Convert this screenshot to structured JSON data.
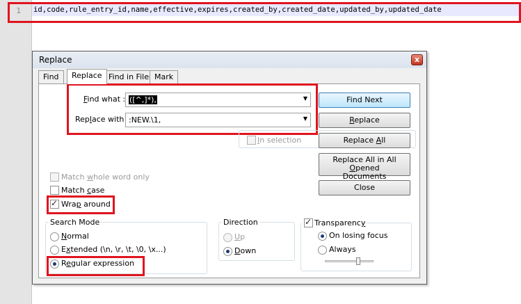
{
  "editor": {
    "line_number": "1",
    "code_line": "id,code,rule_entry_id,name,effective,expires,created_by,created_date,updated_by,updated_date"
  },
  "dialog": {
    "title": "Replace",
    "close_glyph": "x",
    "tabs": [
      "Find",
      "Replace",
      "Find in Files",
      "Mark"
    ],
    "active_tab": "Replace",
    "find_what": {
      "label_prefix": "",
      "label_mnemonic": "F",
      "label_rest": "ind what :",
      "value": "([^,]*),"
    },
    "replace_with": {
      "label_pre": "Rep",
      "label_mnemonic": "l",
      "label_post": "ace with :",
      "value": ":NEW.\\1,"
    },
    "in_selection": {
      "pre": "",
      "mnemonic": "I",
      "post": "n selection"
    },
    "buttons": {
      "find_next": "Find Next",
      "replace": {
        "mnemonic": "R",
        "rest": "eplace"
      },
      "replace_all": {
        "pre": "Replace ",
        "mnemonic": "A",
        "post": "ll"
      },
      "replace_all_opened_l1_pre": "Replace All in All ",
      "replace_all_opened_l1_mn": "O",
      "replace_all_opened_l1_post": "pened",
      "replace_all_opened_l2": "Documents",
      "close": "Close"
    },
    "options": {
      "match_whole_word": {
        "pre": "Match ",
        "mnemonic": "w",
        "post": "hole word only"
      },
      "match_case": {
        "pre": "Match ",
        "mnemonic": "c",
        "post": "ase"
      },
      "wrap_around": {
        "pre": "Wra",
        "mnemonic": "p",
        "post": " around"
      }
    },
    "search_mode": {
      "title": "Search Mode",
      "normal": {
        "pre": "",
        "mnemonic": "N",
        "post": "ormal"
      },
      "extended": {
        "pre": "E",
        "mnemonic": "x",
        "post": "tended (\\n, \\r, \\t, \\0, \\x...)"
      },
      "regex": {
        "pre": "R",
        "mnemonic": "e",
        "post": "gular expression"
      }
    },
    "direction": {
      "title": "Direction",
      "up": {
        "mnemonic": "U",
        "post": "p"
      },
      "down": {
        "mnemonic": "D",
        "post": "own"
      }
    },
    "transparency": {
      "pre": "Transparenc",
      "mnemonic": "y",
      "on_losing_focus": "On losing focus",
      "always": "Always"
    }
  },
  "colors": {
    "highlight_red": "#e0141e",
    "line_highlight": "#e8e8ff"
  }
}
